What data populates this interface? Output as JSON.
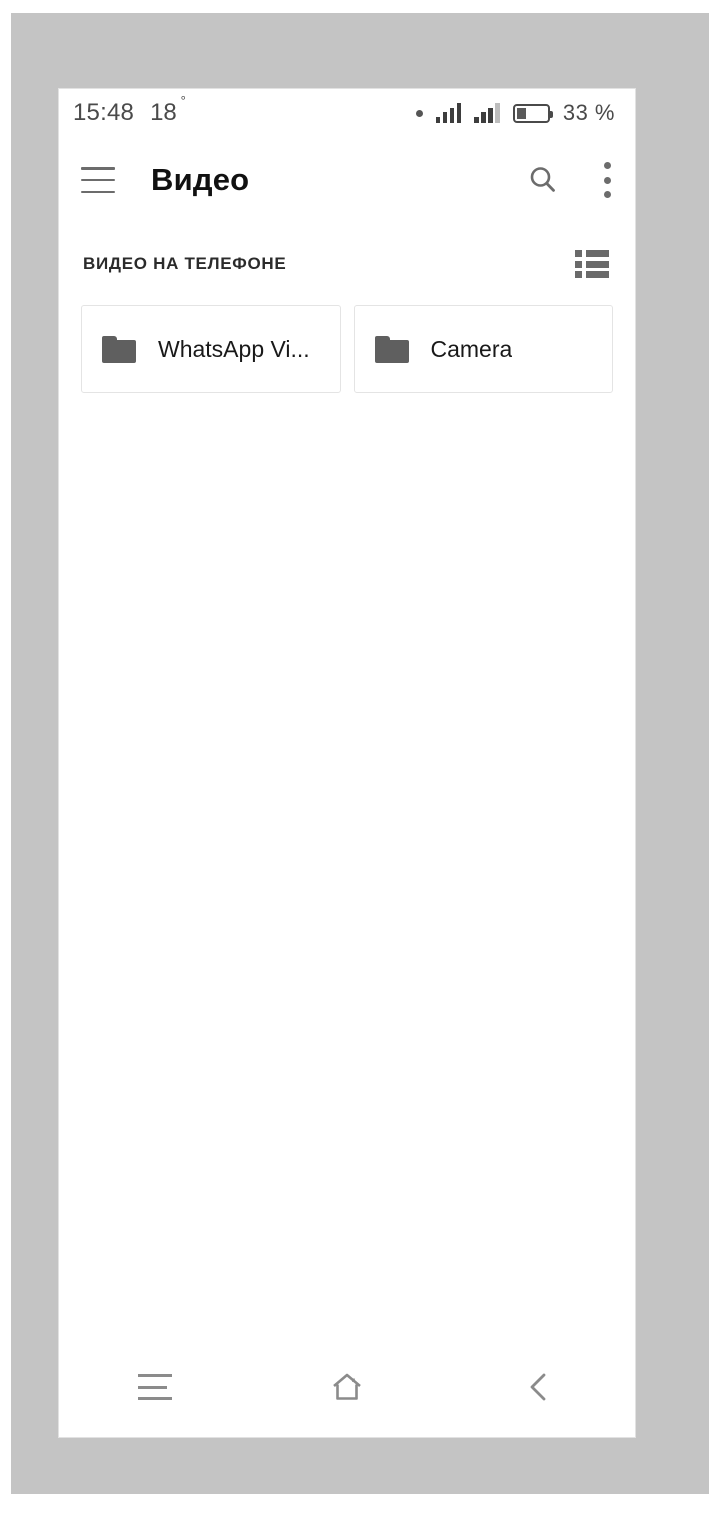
{
  "status_bar": {
    "time": "15:48",
    "temperature": "18",
    "degree_symbol": "°",
    "dot_icon": "dot-indicator-icon",
    "signal_1_icon": "signal-bars-icon",
    "signal_2_icon": "signal-bars-icon",
    "battery_icon": "battery-icon",
    "battery_percent_text": "33 %",
    "battery_level": 33
  },
  "app_bar": {
    "menu_icon": "hamburger-menu-icon",
    "title": "Видео",
    "search_icon": "search-icon",
    "overflow_icon": "more-vertical-icon"
  },
  "section": {
    "title": "ВИДЕО НА ТЕЛЕФОНЕ",
    "view_toggle_icon": "list-view-icon"
  },
  "folders": [
    {
      "name": "WhatsApp Vi...",
      "icon": "folder-icon"
    },
    {
      "name": "Camera",
      "icon": "folder-icon"
    }
  ],
  "nav_bar": {
    "recents_icon": "recent-apps-icon",
    "home_icon": "home-icon",
    "back_icon": "back-chevron-icon"
  },
  "colors": {
    "backdrop": "#c4c4c4",
    "screen": "#ffffff",
    "title_text": "#111111",
    "icon_gray": "#6c6c6c",
    "folder_gray": "#5f5f5f",
    "nav_gray": "#8b8b8b",
    "card_border": "#e4e4e4"
  }
}
